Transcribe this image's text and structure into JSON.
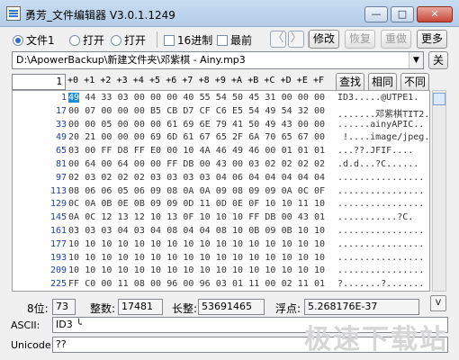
{
  "window": {
    "title": "勇芳_文件编辑器 V3.0.1.1249",
    "min_label": "—",
    "max_label": "□",
    "close_label": "✕"
  },
  "toolbar": {
    "radio_file1": "文件1",
    "radio_open1": "打开",
    "radio_open2": "打开",
    "check_hex": "16进制",
    "check_top": "最前",
    "nav_prev": "〈",
    "nav_next": "〉",
    "modify": "修改",
    "restore": "恢复",
    "redo": "重做",
    "more": "更多"
  },
  "path": {
    "value": "D:\\ApowerBackup\\新建文件夹\\邓紫棋 - Ainy.mp3",
    "close_label": "关"
  },
  "hex": {
    "offset": "1",
    "columns": [
      "+0",
      "+1",
      "+2",
      "+3",
      "+4",
      "+5",
      "+6",
      "+7",
      "+8",
      "+9",
      "+A",
      "+B",
      "+C",
      "+D",
      "+E",
      "+F"
    ],
    "rows": [
      {
        "addr": "1",
        "bytes": [
          "49",
          "44",
          "33",
          "03",
          "00",
          "00",
          "00",
          "40",
          "55",
          "54",
          "50",
          "45",
          "31",
          "00",
          "00",
          "00"
        ],
        "ascii": "ID3.....@UTPE1."
      },
      {
        "addr": "17",
        "bytes": [
          "00",
          "07",
          "00",
          "00",
          "00",
          "B5",
          "CB",
          "D7",
          "CF",
          "C6",
          "E5",
          "54",
          "49",
          "54",
          "32",
          "00"
        ],
        "ascii": ".......邓紫棋TIT2."
      },
      {
        "addr": "33",
        "bytes": [
          "00",
          "00",
          "05",
          "00",
          "00",
          "00",
          "61",
          "69",
          "6E",
          "79",
          "41",
          "50",
          "49",
          "43",
          "00",
          "00"
        ],
        "ascii": "......ainyAPIC.."
      },
      {
        "addr": "49",
        "bytes": [
          "20",
          "21",
          "00",
          "00",
          "00",
          "69",
          "6D",
          "61",
          "67",
          "65",
          "2F",
          "6A",
          "70",
          "65",
          "67",
          "00"
        ],
        "ascii": " !....image/jpeg."
      },
      {
        "addr": "65",
        "bytes": [
          "03",
          "00",
          "FF",
          "D8",
          "FF",
          "E0",
          "00",
          "10",
          "4A",
          "46",
          "49",
          "46",
          "00",
          "01",
          "01",
          "01"
        ],
        "ascii": "...??.JFIF...."
      },
      {
        "addr": "81",
        "bytes": [
          "00",
          "64",
          "00",
          "64",
          "00",
          "00",
          "FF",
          "DB",
          "00",
          "43",
          "00",
          "03",
          "02",
          "02",
          "02",
          "02"
        ],
        "ascii": ".d.d...?C......"
      },
      {
        "addr": "97",
        "bytes": [
          "02",
          "03",
          "02",
          "02",
          "02",
          "03",
          "03",
          "03",
          "03",
          "04",
          "06",
          "04",
          "04",
          "04",
          "04",
          "04"
        ],
        "ascii": "................"
      },
      {
        "addr": "113",
        "bytes": [
          "08",
          "06",
          "06",
          "05",
          "06",
          "09",
          "08",
          "0A",
          "0A",
          "09",
          "08",
          "09",
          "09",
          "0A",
          "0C",
          "0F"
        ],
        "ascii": "................"
      },
      {
        "addr": "129",
        "bytes": [
          "0C",
          "0A",
          "0B",
          "0E",
          "0B",
          "09",
          "09",
          "0D",
          "11",
          "0D",
          "0E",
          "0F",
          "10",
          "10",
          "11",
          "10"
        ],
        "ascii": "................"
      },
      {
        "addr": "145",
        "bytes": [
          "0A",
          "0C",
          "12",
          "13",
          "12",
          "10",
          "13",
          "0F",
          "10",
          "10",
          "10",
          "FF",
          "DB",
          "00",
          "43",
          "01"
        ],
        "ascii": "...........?C."
      },
      {
        "addr": "161",
        "bytes": [
          "03",
          "03",
          "03",
          "04",
          "03",
          "04",
          "08",
          "04",
          "04",
          "08",
          "10",
          "0B",
          "09",
          "0B",
          "10",
          "10"
        ],
        "ascii": "................"
      },
      {
        "addr": "177",
        "bytes": [
          "10",
          "10",
          "10",
          "10",
          "10",
          "10",
          "10",
          "10",
          "10",
          "10",
          "10",
          "10",
          "10",
          "10",
          "10",
          "10"
        ],
        "ascii": "................"
      },
      {
        "addr": "193",
        "bytes": [
          "10",
          "10",
          "10",
          "10",
          "10",
          "10",
          "10",
          "10",
          "10",
          "10",
          "10",
          "10",
          "10",
          "10",
          "10",
          "10"
        ],
        "ascii": "................"
      },
      {
        "addr": "209",
        "bytes": [
          "10",
          "10",
          "10",
          "10",
          "10",
          "10",
          "10",
          "10",
          "10",
          "10",
          "10",
          "10",
          "10",
          "10",
          "10",
          "10"
        ],
        "ascii": "................"
      },
      {
        "addr": "225",
        "bytes": [
          "FF",
          "C0",
          "00",
          "11",
          "08",
          "00",
          "96",
          "00",
          "96",
          "03",
          "01",
          "11",
          "00",
          "02",
          "11",
          "01"
        ],
        "ascii": "?.......?......."
      }
    ]
  },
  "side_tools": {
    "find": "查找",
    "same": "相同",
    "diff": "不同",
    "scroll_down": "V"
  },
  "values": {
    "bit8_label": "8位:",
    "bit8_value": "73",
    "int_label": "整数:",
    "int_value": "17481",
    "long_label": "长整:",
    "long_value": "53691465",
    "float_label": "浮点:",
    "float_value": "5.268176E-37"
  },
  "text_fields": {
    "ascii_label": "ASCII:",
    "ascii_value": "ID3 ╰",
    "unicode_label": "Unicode:",
    "unicode_value": "??"
  },
  "watermark": "极速下载站"
}
